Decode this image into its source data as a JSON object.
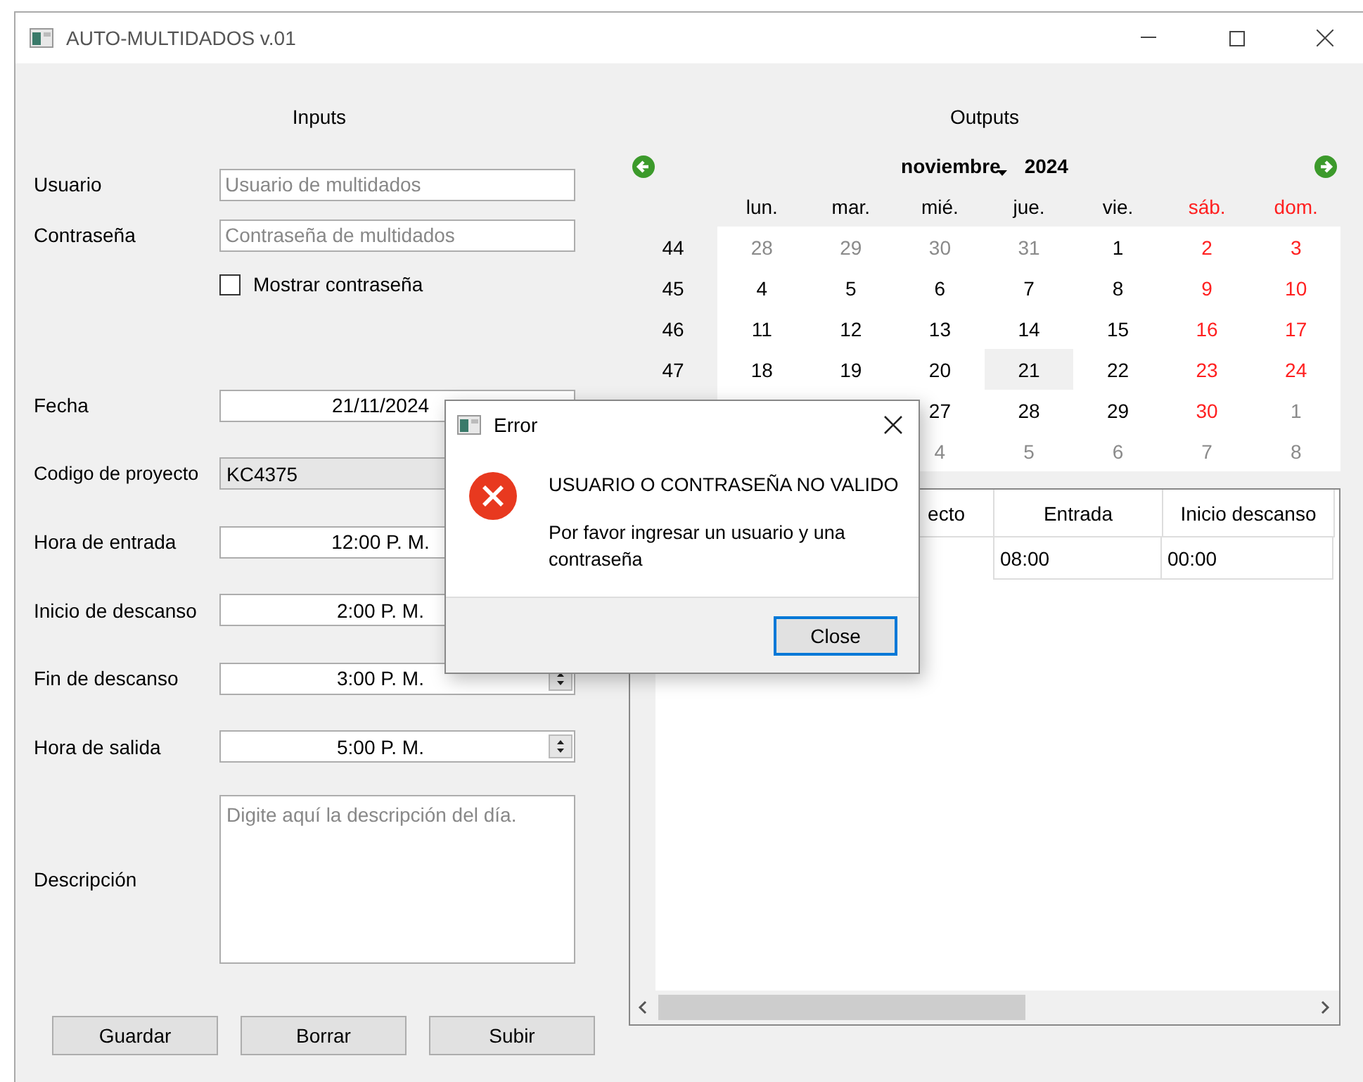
{
  "window": {
    "title": "AUTO-MULTIDADOS v.01"
  },
  "inputs": {
    "title": "Inputs",
    "fields": [
      {
        "kind": "text",
        "label": "Usuario",
        "placeholder": "Usuario de multidados"
      },
      {
        "kind": "text",
        "label": "Contraseña",
        "placeholder": "Contraseña de multidados"
      },
      {
        "kind": "checkbox",
        "label": "Mostrar contraseña",
        "checked": false
      },
      {
        "kind": "date",
        "label": "Fecha",
        "value": "21/11/2024"
      },
      {
        "kind": "readonly",
        "label": "Codigo de proyecto",
        "value": "KC4375"
      },
      {
        "kind": "time",
        "label": "Hora de entrada",
        "value": "12:00 P. M."
      },
      {
        "kind": "time",
        "label": "Inicio de descanso",
        "value": "2:00 P. M."
      },
      {
        "kind": "time",
        "label": "Fin de descanso",
        "value": "3:00 P. M.",
        "spinner": true
      },
      {
        "kind": "time",
        "label": "Hora de salida",
        "value": "5:00 P. M.",
        "spinner": true
      },
      {
        "kind": "textarea",
        "label": "Descripción",
        "placeholder": "Digite aquí la descripción del día."
      }
    ],
    "buttons": [
      "Guardar",
      "Borrar",
      "Subir"
    ]
  },
  "outputs": {
    "title": "Outputs",
    "calendar": {
      "month": "noviembre",
      "year": "2024",
      "weekdays": [
        {
          "label": "lun.",
          "weekend": false
        },
        {
          "label": "mar.",
          "weekend": false
        },
        {
          "label": "mié.",
          "weekend": false
        },
        {
          "label": "jue.",
          "weekend": false
        },
        {
          "label": "vie.",
          "weekend": false
        },
        {
          "label": "sáb.",
          "weekend": true
        },
        {
          "label": "dom.",
          "weekend": true
        }
      ],
      "weeks": [
        {
          "week": "44",
          "days": [
            {
              "day": "28",
              "kind": "outside",
              "selected": false
            },
            {
              "day": "29",
              "kind": "outside",
              "selected": false
            },
            {
              "day": "30",
              "kind": "outside",
              "selected": false
            },
            {
              "day": "31",
              "kind": "outside",
              "selected": false
            },
            {
              "day": "1",
              "kind": "weekday",
              "selected": false
            },
            {
              "day": "2",
              "kind": "weekend",
              "selected": false
            },
            {
              "day": "3",
              "kind": "weekend",
              "selected": false
            }
          ]
        },
        {
          "week": "45",
          "days": [
            {
              "day": "4",
              "kind": "weekday",
              "selected": false
            },
            {
              "day": "5",
              "kind": "weekday",
              "selected": false
            },
            {
              "day": "6",
              "kind": "weekday",
              "selected": false
            },
            {
              "day": "7",
              "kind": "weekday",
              "selected": false
            },
            {
              "day": "8",
              "kind": "weekday",
              "selected": false
            },
            {
              "day": "9",
              "kind": "weekend",
              "selected": false
            },
            {
              "day": "10",
              "kind": "weekend",
              "selected": false
            }
          ]
        },
        {
          "week": "46",
          "days": [
            {
              "day": "11",
              "kind": "weekday",
              "selected": false
            },
            {
              "day": "12",
              "kind": "weekday",
              "selected": false
            },
            {
              "day": "13",
              "kind": "weekday",
              "selected": false
            },
            {
              "day": "14",
              "kind": "weekday",
              "selected": false
            },
            {
              "day": "15",
              "kind": "weekday",
              "selected": false
            },
            {
              "day": "16",
              "kind": "weekend",
              "selected": false
            },
            {
              "day": "17",
              "kind": "weekend",
              "selected": false
            }
          ]
        },
        {
          "week": "47",
          "days": [
            {
              "day": "18",
              "kind": "weekday",
              "selected": false
            },
            {
              "day": "19",
              "kind": "weekday",
              "selected": false
            },
            {
              "day": "20",
              "kind": "weekday",
              "selected": false
            },
            {
              "day": "21",
              "kind": "weekday",
              "selected": true
            },
            {
              "day": "22",
              "kind": "weekday",
              "selected": false
            },
            {
              "day": "23",
              "kind": "weekend",
              "selected": false
            },
            {
              "day": "24",
              "kind": "weekend",
              "selected": false
            }
          ]
        },
        {
          "days": [
            {
              "day": "27",
              "kind": "weekday",
              "selected": false
            },
            {
              "day": "28",
              "kind": "weekday",
              "selected": false
            },
            {
              "day": "29",
              "kind": "weekday",
              "selected": false
            },
            {
              "day": "30",
              "kind": "weekend",
              "selected": false
            },
            {
              "day": "1",
              "kind": "outside",
              "selected": false
            }
          ]
        },
        {
          "days": [
            {
              "day": "4",
              "kind": "outside",
              "selected": false
            },
            {
              "day": "5",
              "kind": "outside",
              "selected": false
            },
            {
              "day": "6",
              "kind": "outside",
              "selected": false
            },
            {
              "day": "7",
              "kind": "outside",
              "selected": false
            },
            {
              "day": "8",
              "kind": "outside",
              "selected": false
            }
          ]
        }
      ]
    },
    "table": {
      "columns": [
        "ecto",
        "Entrada",
        "Inicio descanso"
      ],
      "rows": [
        [
          "",
          "08:00",
          "00:00"
        ]
      ]
    }
  },
  "dialog": {
    "title": "Error",
    "heading": "USUARIO O CONTRASEÑA NO VALIDO",
    "message": "Por favor ingresar un usuario y una contraseña",
    "button": "Close"
  }
}
